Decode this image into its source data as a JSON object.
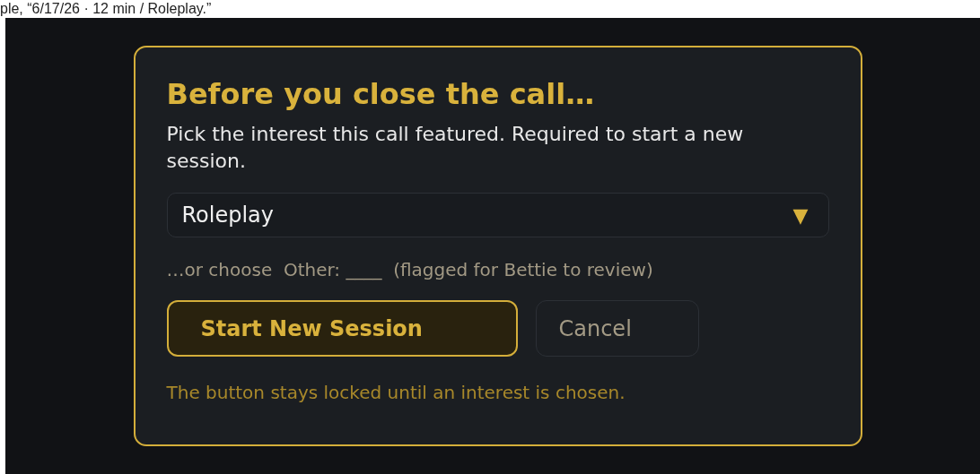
{
  "caption": "ple, “6/17/26 · 12 min / Roleplay.”",
  "dialog": {
    "title": "Before you close the call…",
    "description": "Pick the interest this call featured. Required to start a new session.",
    "interest_select": {
      "value": "Roleplay"
    },
    "dropdown_caret": "▼",
    "other_hint": "…or choose  Other: ____  (flagged for Bettie to review)",
    "buttons": [
      {
        "label": "Start New Session",
        "kind": "primary"
      },
      {
        "label": "Cancel",
        "kind": "secondary"
      }
    ],
    "footer_note": "The button stays locked until an interest is chosen."
  }
}
